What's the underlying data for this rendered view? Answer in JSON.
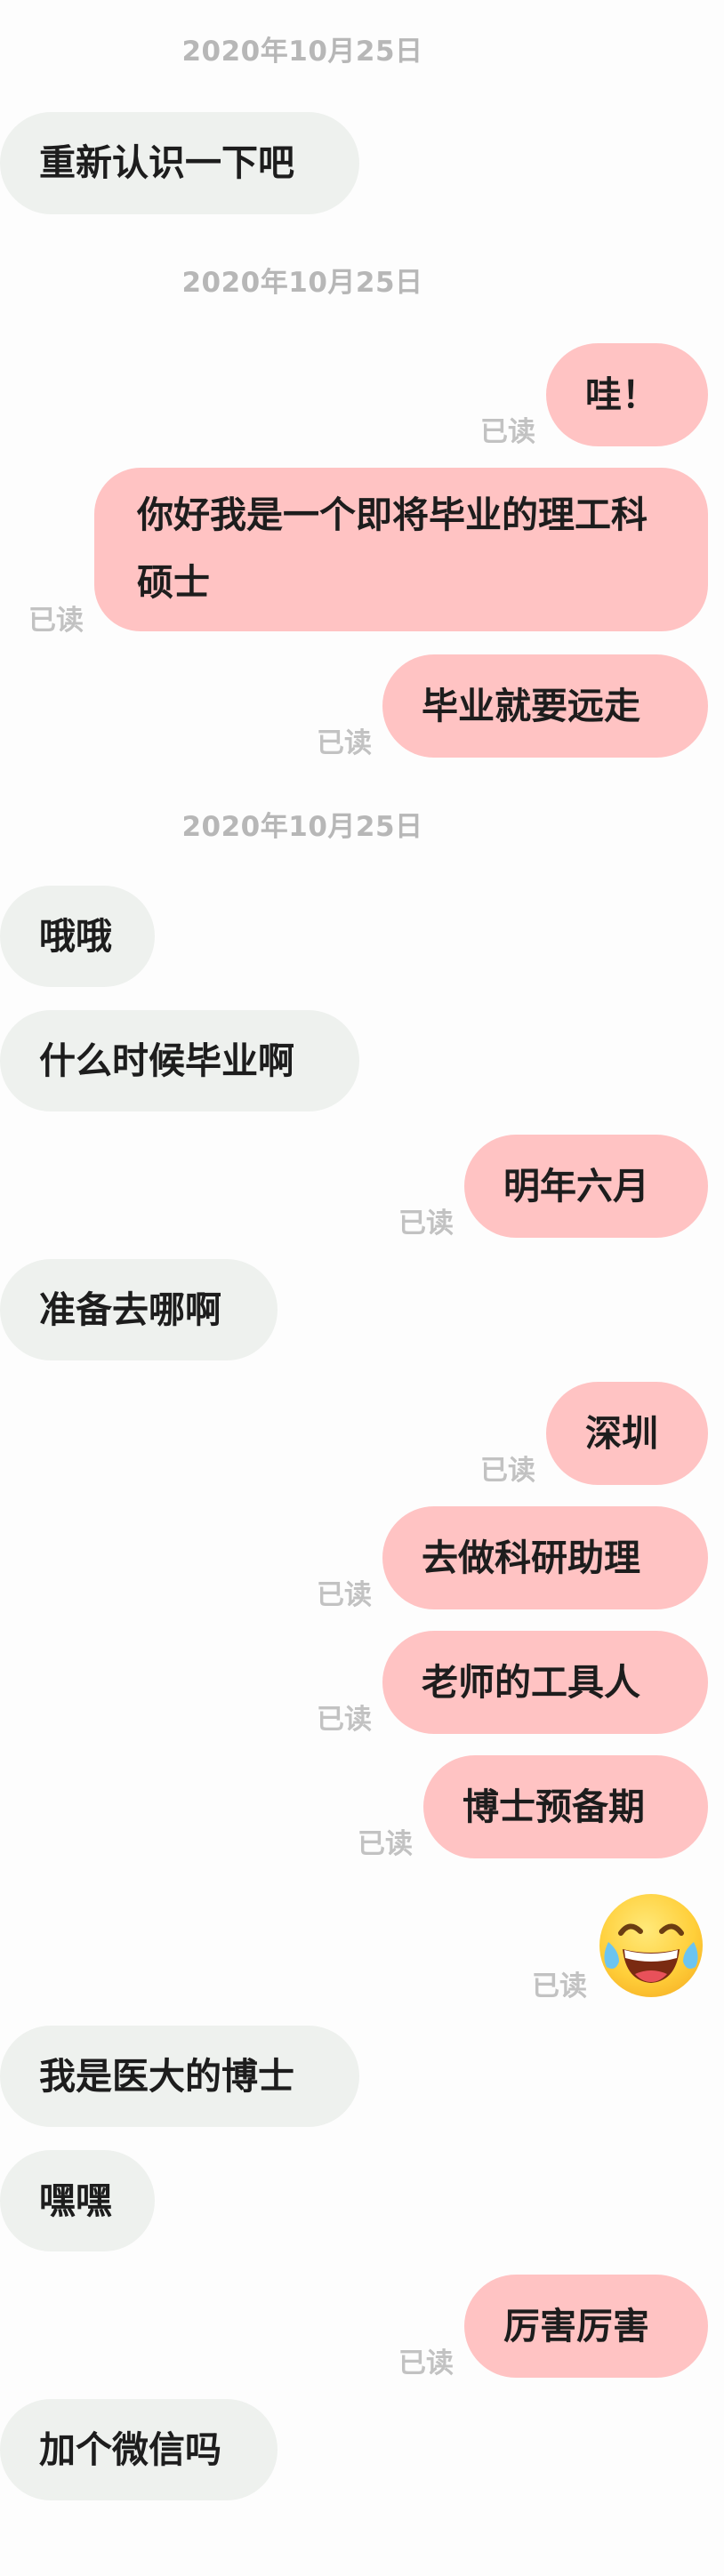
{
  "timestamps": [
    "2020年10月25日",
    "2020年10月25日",
    "2020年10月25日"
  ],
  "read_label": "已读",
  "messages": [
    {
      "side": "left",
      "text": "重新认识一下吧"
    },
    {
      "side": "right",
      "text": "哇！"
    },
    {
      "side": "right",
      "text": "你好我是一个即将毕业的理工科硕士"
    },
    {
      "side": "right",
      "text": "毕业就要远走"
    },
    {
      "side": "left",
      "text": "哦哦"
    },
    {
      "side": "left",
      "text": "什么时候毕业啊"
    },
    {
      "side": "right",
      "text": "明年六月"
    },
    {
      "side": "left",
      "text": "准备去哪啊"
    },
    {
      "side": "right",
      "text": "深圳"
    },
    {
      "side": "right",
      "text": "去做科研助理"
    },
    {
      "side": "right",
      "text": "老师的工具人"
    },
    {
      "side": "right",
      "text": "博士预备期"
    },
    {
      "side": "right",
      "emoji": "face-with-tears-of-joy-emoji"
    },
    {
      "side": "left",
      "text": "我是医大的博士"
    },
    {
      "side": "left",
      "text": "嘿嘿"
    },
    {
      "side": "right",
      "text": "厉害厉害"
    },
    {
      "side": "left",
      "text": "加个微信吗"
    }
  ]
}
